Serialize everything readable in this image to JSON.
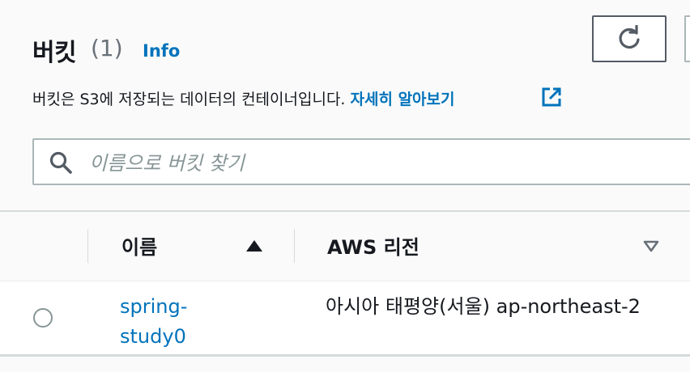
{
  "header": {
    "title": "버킷",
    "count": "(1)",
    "info_link": "Info"
  },
  "description": {
    "text": "버킷은 S3에 저장되는 데이터의 컨테이너입니다. ",
    "learn_more": "자세히 알아보기"
  },
  "search": {
    "placeholder": "이름으로 버킷 찾기"
  },
  "table": {
    "columns": [
      {
        "label": "이름",
        "sort": "ascending"
      },
      {
        "label": "AWS 리전",
        "sort": "none"
      }
    ],
    "rows": [
      {
        "name": "spring-study0",
        "region": "아시아 태평양(서울) ap-northeast-2",
        "selected": false
      }
    ]
  },
  "colors": {
    "link": "#0073bb",
    "text": "#16191f",
    "border": "#aab7b8",
    "background": "#fafafa"
  },
  "icons": [
    "refresh-icon",
    "external-link-icon",
    "search-icon",
    "sort-ascending-icon",
    "sort-descending-icon"
  ]
}
